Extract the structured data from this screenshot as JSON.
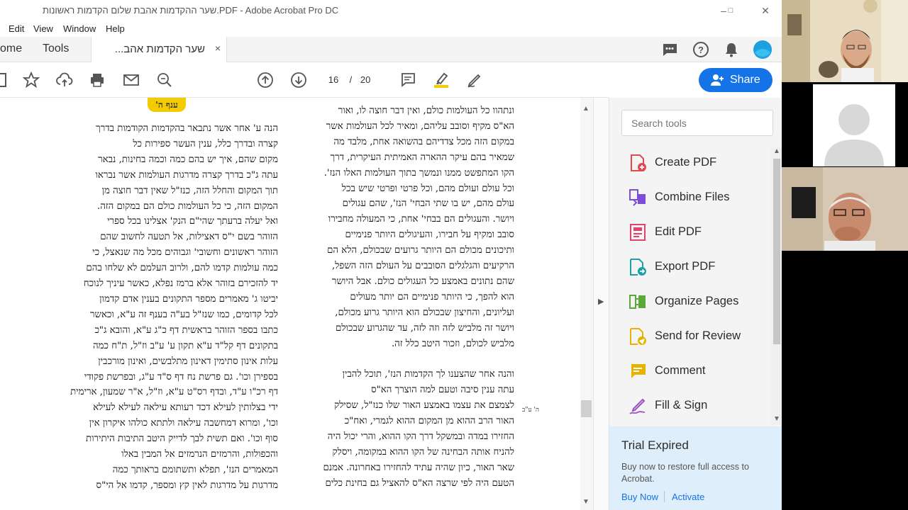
{
  "window": {
    "title": "שער ההקדמות אהבת שלום הקדמות ראשונות.PDF - Adobe Acrobat Pro DC"
  },
  "menu": {
    "items": [
      "Edit",
      "View",
      "Window",
      "Help"
    ]
  },
  "tabs": {
    "home": "ome",
    "tools": "Tools",
    "document": "שער הקדמות אהב...",
    "close_glyph": "×"
  },
  "toolbar": {
    "current_page": "16",
    "page_separator": "/",
    "total_pages": "20"
  },
  "share": {
    "label": "Share"
  },
  "document": {
    "header_badge": "ענף ה'",
    "margin_note": "ה' ע\"ב",
    "left_column": [
      "הנה ע' אחר אשר נתבאר בהקדמות הקודמות בדרך",
      "קצרה ובדרך כלל, ענין העשר ספירות כל",
      "מקום שהם, איך יש בהם כמה וכמה בחינות, נבאר",
      "עתה ג\"כ בדרך קצרה מדרגות העולמות אשר נבראו",
      "תוך המקום והחלל הזה, כנז\"ל שאין דבר חוצה מן",
      "המקום הזה, כי כל העולמות כולם הם במקום הזה.",
      "ואל יעלה ברעתך שהי\"ם הנק' אצלינו בכל ספרי",
      "הזוהר בשם י\"ס דאצילות, אל תטעה לחשוב שהם",
      "הזוהר ראשונים וחשובי' וגבוהים מכל מה שנאצל, כי",
      "כמה עולמות קדמו להם, ולרוב העלמם לא שלחו בהם",
      "יד להזכירם בזוהר אלא ברמז נפלא, כאשר עיניך לנוכח",
      "יביטו ג' מאמרים מספר התקונים בענין אדם קדמון",
      "לכל קדומים, כמו שנז\"ל בע\"ה בענף זה ע\"א, וכאשר",
      "כתבו בספר הזוהר בראשית דף כ\"ג ע\"א, והובא ג\"כ",
      "בתקונים דף קל\"ד ע\"א תקון ע' ע\"ב וז\"ל, ת\"ח כמה",
      "עלות אינון סתימין דאינון מתלבשים, ואינון מורכבין",
      "בספירן וכו'. גם פרשת נח דף ס\"ד ע\"ג, ובפרשת פקודי",
      "דף רכ\"ו ע\"ד, ובדף רס\"ט ע\"א, וז\"ל, א\"ר שמעון, ארימית",
      "ידי בצלותין לעילא דכד רעותא עילאה לעילא לעילא",
      "וכו', ומרוא דמחשבה עילאה ולתתא כולהו איקרון אין",
      "סוף וכו'. ואם תשית לבך לדייק היטב התיבות היתירות",
      "והכפולות, והרמזים הנרמזים אל המבין באלו",
      "המאמרים הנז', תפלא ותשתומם בראותך כמה",
      "מדרגות על מדרגות לאין קץ ומספר, קדמו אל הי\"ס"
    ],
    "right_column": [
      "ונתהוו כל העולמות כולם, ואין דבר חוצה לו, ואור",
      "הא\"ס מקיף וסובב עליהם, ומאיר לכל העולמות אשר",
      "במקום הזה מכל צדדיהם בהשואה אחת, מלבד מה",
      "שמאיר בהם עיקר ההארה האמיתית העיקרית, דרך",
      "הקו המתפשט ממנו ונמשך בתוך העולמות האלו הנז'.",
      "וכל עולם ועולם מהם, וכל פרטי ופרטי שיש בכל",
      "עולם מהם, יש בו שתי הבחי' הנז', שהם עגולים",
      "ויושר. והעגולים הם בבחי' אחת, כי המעולה מחבירו",
      "סובב ומקיף על חבירו, והעיגולים היותר פנימיים",
      "ותיכונים מכולם הם היותר גרועים שבכולם, הלא הם",
      "הרקיעים והגלגלים הסובבים על העולם הזה השפל,",
      "שהם נתונים באמצע כל העגולים כולם. אבל היושר",
      "הוא להפך, כי היותר פנימיים הם יותר מעולים",
      "ועליונים, והחיצון שבכולם הוא היותר גרוע מכולם,",
      "ויושר זה מלביש לזה וזה לזה, עד שהגרוע שבכולם",
      "מלביש לכולם, וזכור היטב כלל זה.",
      "",
      "והנה אחר שהצענו לך הקדמות הנז', תוכל להבין",
      "עתה ענין סיבה וטעם למה הוצרך הא\"ס",
      "לצמצם את עצמו באמצע האור שלו כנז\"ל, שסילק",
      "האור הרב ההוא מן המקום ההוא לגמרי, ואח\"כ",
      "החזירו במדה ובמשקל דרך הקו ההוא, והרי יכול היה",
      "להניח אותה הבחינה של הקו ההוא במקומה, ויסלק",
      "שאר האור, כיון שהיה עתיד להחזירו באחרונה. אמנם",
      "הטעם היה לפי שרצה הא\"ס להאציל גם בחינת כלים"
    ]
  },
  "tools_pane": {
    "search_placeholder": "Search tools",
    "tools": [
      {
        "label": "Create PDF",
        "icon": "create-pdf-icon",
        "color": "#e34850"
      },
      {
        "label": "Combine Files",
        "icon": "combine-files-icon",
        "color": "#7c4dd6"
      },
      {
        "label": "Edit PDF",
        "icon": "edit-pdf-icon",
        "color": "#e2436d"
      },
      {
        "label": "Export PDF",
        "icon": "export-pdf-icon",
        "color": "#1ca0a8"
      },
      {
        "label": "Organize Pages",
        "icon": "organize-pages-icon",
        "color": "#5ca93a"
      },
      {
        "label": "Send for Review",
        "icon": "send-for-review-icon",
        "color": "#e6b400"
      },
      {
        "label": "Comment",
        "icon": "comment-icon",
        "color": "#e6b400"
      },
      {
        "label": "Fill & Sign",
        "icon": "fill-sign-icon",
        "color": "#9a52c6"
      }
    ],
    "trial": {
      "title": "Trial Expired",
      "message": "Buy now to restore full access to Acrobat.",
      "buy_label": "Buy Now",
      "activate_label": "Activate"
    }
  },
  "colors": {
    "accent": "#1473e6",
    "highlight_badge": "#f2cc00",
    "trial_bg": "#dfeefb"
  }
}
